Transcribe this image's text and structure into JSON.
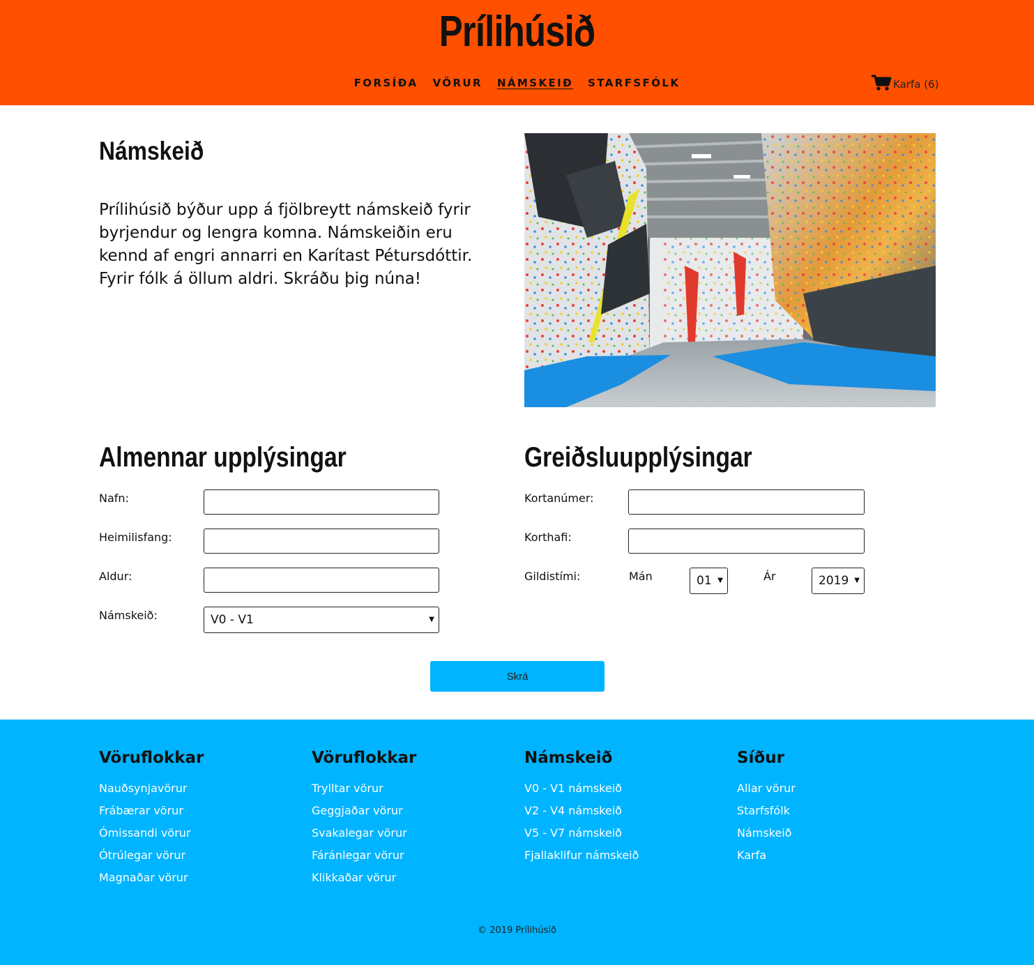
{
  "header": {
    "site_title": "Prílihúsið",
    "nav": [
      {
        "label": "FORSÍÐA"
      },
      {
        "label": "VÖRUR"
      },
      {
        "label": "NÁMSKEIÐ",
        "active": true
      },
      {
        "label": "STARFSFÓLK"
      }
    ],
    "cart": {
      "icon": "cart-icon",
      "label": "Karfa (6)"
    }
  },
  "intro": {
    "title": "Námskeið",
    "text": "Prílihúsið býður upp á fjölbreytt námskeið fyrir byrjendur og lengra komna. Námskeiðin eru kennd af engri annarri en Karítast Pétursdóttir. Fyrir fólk á öllum aldri. Skráðu þig núna!",
    "image": "climbing-gym-photo"
  },
  "general": {
    "title": "Almennar upplýsingar",
    "name_label": "Nafn:",
    "address_label": "Heimilisfang:",
    "age_label": "Aldur:",
    "course_label": "Námskeið:",
    "course_value": "V0 - V1"
  },
  "payment": {
    "title": "Greiðsluupplýsingar",
    "card_number_label": "Kortanúmer:",
    "card_holder_label": "Korthafi:",
    "expiry_label": "Gildistími:",
    "month_label": "Mán",
    "month_value": "01",
    "year_label": "Ár",
    "year_value": "2019"
  },
  "submit_label": "Skrá",
  "footer": {
    "columns": [
      {
        "heading": "Vöruflokkar",
        "links": [
          "Nauðsynjavörur",
          "Frábærar vörur",
          "Ómissandi vörur",
          "Ótrúlegar vörur",
          "Magnaðar vörur"
        ]
      },
      {
        "heading": "Vöruflokkar",
        "links": [
          "Trylltar vörur",
          "Geggjaðar vörur",
          "Svakalegar vörur",
          "Fáránlegar vörur",
          "Klikkaðar vörur"
        ]
      },
      {
        "heading": "Námskeið",
        "links": [
          "V0 - V1 námskeið",
          "V2 - V4 námskeið",
          "V5 - V7 námskeið",
          "Fjallaklifur námskeið"
        ]
      },
      {
        "heading": "Síður",
        "links": [
          "Allar vörur",
          "Starfsfólk",
          "Námskeið",
          "Karfa"
        ]
      }
    ],
    "copyright": "© 2019 Prílihúsið"
  },
  "colors": {
    "header": "#ff5000",
    "accent": "#00b4ff",
    "footer_link": "#ffffff"
  }
}
